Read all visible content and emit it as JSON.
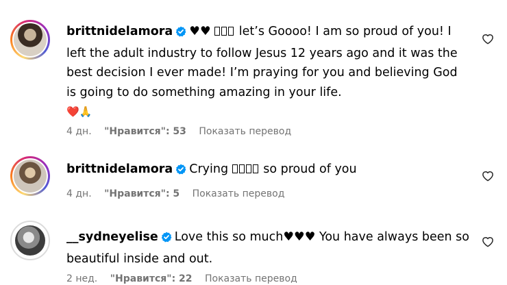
{
  "comments": [
    {
      "username": "brittnidelamora",
      "prefix_emoji": "♥♥",
      "text_first": "let’s Goooo! I am so proud of you!",
      "text_rest": "I left the adult industry to follow Jesus 12 years ago and it was the best decision I ever made! I’m praying for you and believing God is going to do something amazing in your life.",
      "end_emoji": "❤️🙏",
      "time": "4 дн.",
      "likes": "\"Нравится\": 53",
      "translate": "Показать перевод"
    },
    {
      "username": "brittnidelamora",
      "text_first": "Crying",
      "text_rest": "so proud of you",
      "time": "4 дн.",
      "likes": "\"Нравится\": 5",
      "translate": "Показать перевод"
    },
    {
      "username": "__sydneyelise",
      "text_first": "Love this so much",
      "hearts": "♥♥♥",
      "text_rest": "You have always been so beautiful inside and out.",
      "time": "2 нед.",
      "likes": "\"Нравится\": 22",
      "translate": "Показать перевод"
    }
  ],
  "icons": {
    "verified": "verified-badge-icon",
    "like": "heart-outline-icon"
  },
  "colors": {
    "verified": "#0095f6",
    "meta": "#737373"
  }
}
